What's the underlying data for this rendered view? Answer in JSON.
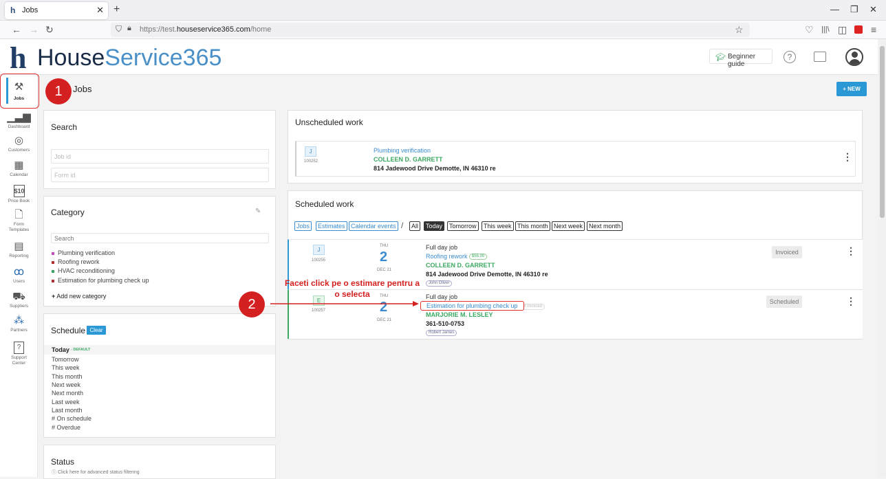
{
  "browser": {
    "tab_title": "Jobs",
    "url_prefix": "https://test.",
    "url_domain": "houseservice365.com",
    "url_path": "/home"
  },
  "header": {
    "logo_letter": "h",
    "logo_part1": "House",
    "logo_part2": "Service365",
    "guide_label": "Beginner guide",
    "help_label": "?"
  },
  "sidebar": {
    "items": [
      {
        "label": "Jobs",
        "icon": "tools-icon"
      },
      {
        "label": "Dashboard",
        "icon": "bar-chart-icon"
      },
      {
        "label": "Customers",
        "icon": "target-icon"
      },
      {
        "label": "Calendar",
        "icon": "calendar-icon"
      },
      {
        "label": "Price Book",
        "icon": "price-icon"
      },
      {
        "label": "Form Templates",
        "icon": "form-icon"
      },
      {
        "label": "Reporting",
        "icon": "report-icon"
      },
      {
        "label": "Users",
        "icon": "users-icon"
      },
      {
        "label": "Suppliers",
        "icon": "truck-icon"
      },
      {
        "label": "Partners",
        "icon": "partners-icon"
      },
      {
        "label": "Support Center",
        "icon": "support-icon"
      }
    ]
  },
  "page": {
    "title": "Jobs",
    "new_button": "+ NEW"
  },
  "annotations": {
    "step1": "1",
    "step2": "2",
    "callout_line1": "Faceti click pe o estimare pentru a",
    "callout_line2": "o selecta"
  },
  "search": {
    "title": "Search",
    "job_id_placeholder": "Job id",
    "form_id_placeholder": "Form id"
  },
  "category": {
    "title": "Category",
    "search_placeholder": "Search",
    "items": [
      {
        "label": "Plumbing verification",
        "color": "#c64ab8"
      },
      {
        "label": "Roofing rework",
        "color": "#b03030"
      },
      {
        "label": "HVAC reconditioning",
        "color": "#3aa860"
      },
      {
        "label": "Estimation for plumbing check up",
        "color": "#b03030"
      }
    ],
    "add_label": "Add new category"
  },
  "schedule": {
    "title": "Schedule",
    "clear_label": "Clear",
    "today": "Today",
    "default_tag": "- DEFAULT",
    "items": [
      "Tomorrow",
      "This week",
      "This month",
      "Next week",
      "Next month",
      "Last week",
      "Last month",
      "# On schedule",
      "# Overdue"
    ]
  },
  "status_panel": {
    "title": "Status",
    "hint": "Click here for advanced status filtering"
  },
  "unscheduled": {
    "title": "Unscheduled work",
    "card": {
      "badge": "J",
      "number": "100252",
      "job": "Plumbing verification",
      "customer": "COLLEEN D. GARRETT",
      "address": "814 Jadewood Drive Demotte, IN 46310 re"
    }
  },
  "scheduled": {
    "title": "Scheduled work",
    "filters_type": [
      "Jobs",
      "Estimates",
      "Calendar events"
    ],
    "separator": "/",
    "filters_time": [
      "All",
      "Today",
      "Tomorrow",
      "This week",
      "This month",
      "Next week",
      "Next month"
    ],
    "active_filter": "Today",
    "cards": [
      {
        "badge": "J",
        "number": "100255",
        "dow": "THU",
        "day": "2",
        "month": "DEC 21",
        "duration": "Full day job",
        "job": "Roofing rework",
        "price": "$55.00",
        "customer": "COLLEEN D. GARRETT",
        "detail": "814 Jadewood Drive Demotte, IN 46310 re",
        "tech": "John Oliver",
        "status": "Invoiced"
      },
      {
        "badge": "E",
        "number": "100257",
        "dow": "THU",
        "day": "2",
        "month": "DEC 21",
        "duration": "Full day job",
        "job": "Estimation for plumbing check up",
        "extra": "Not invoiced",
        "customer": "MARJORIE M. LESLEY",
        "detail": "361-510-0753",
        "tech": "Robert James",
        "status": "Scheduled"
      }
    ]
  }
}
